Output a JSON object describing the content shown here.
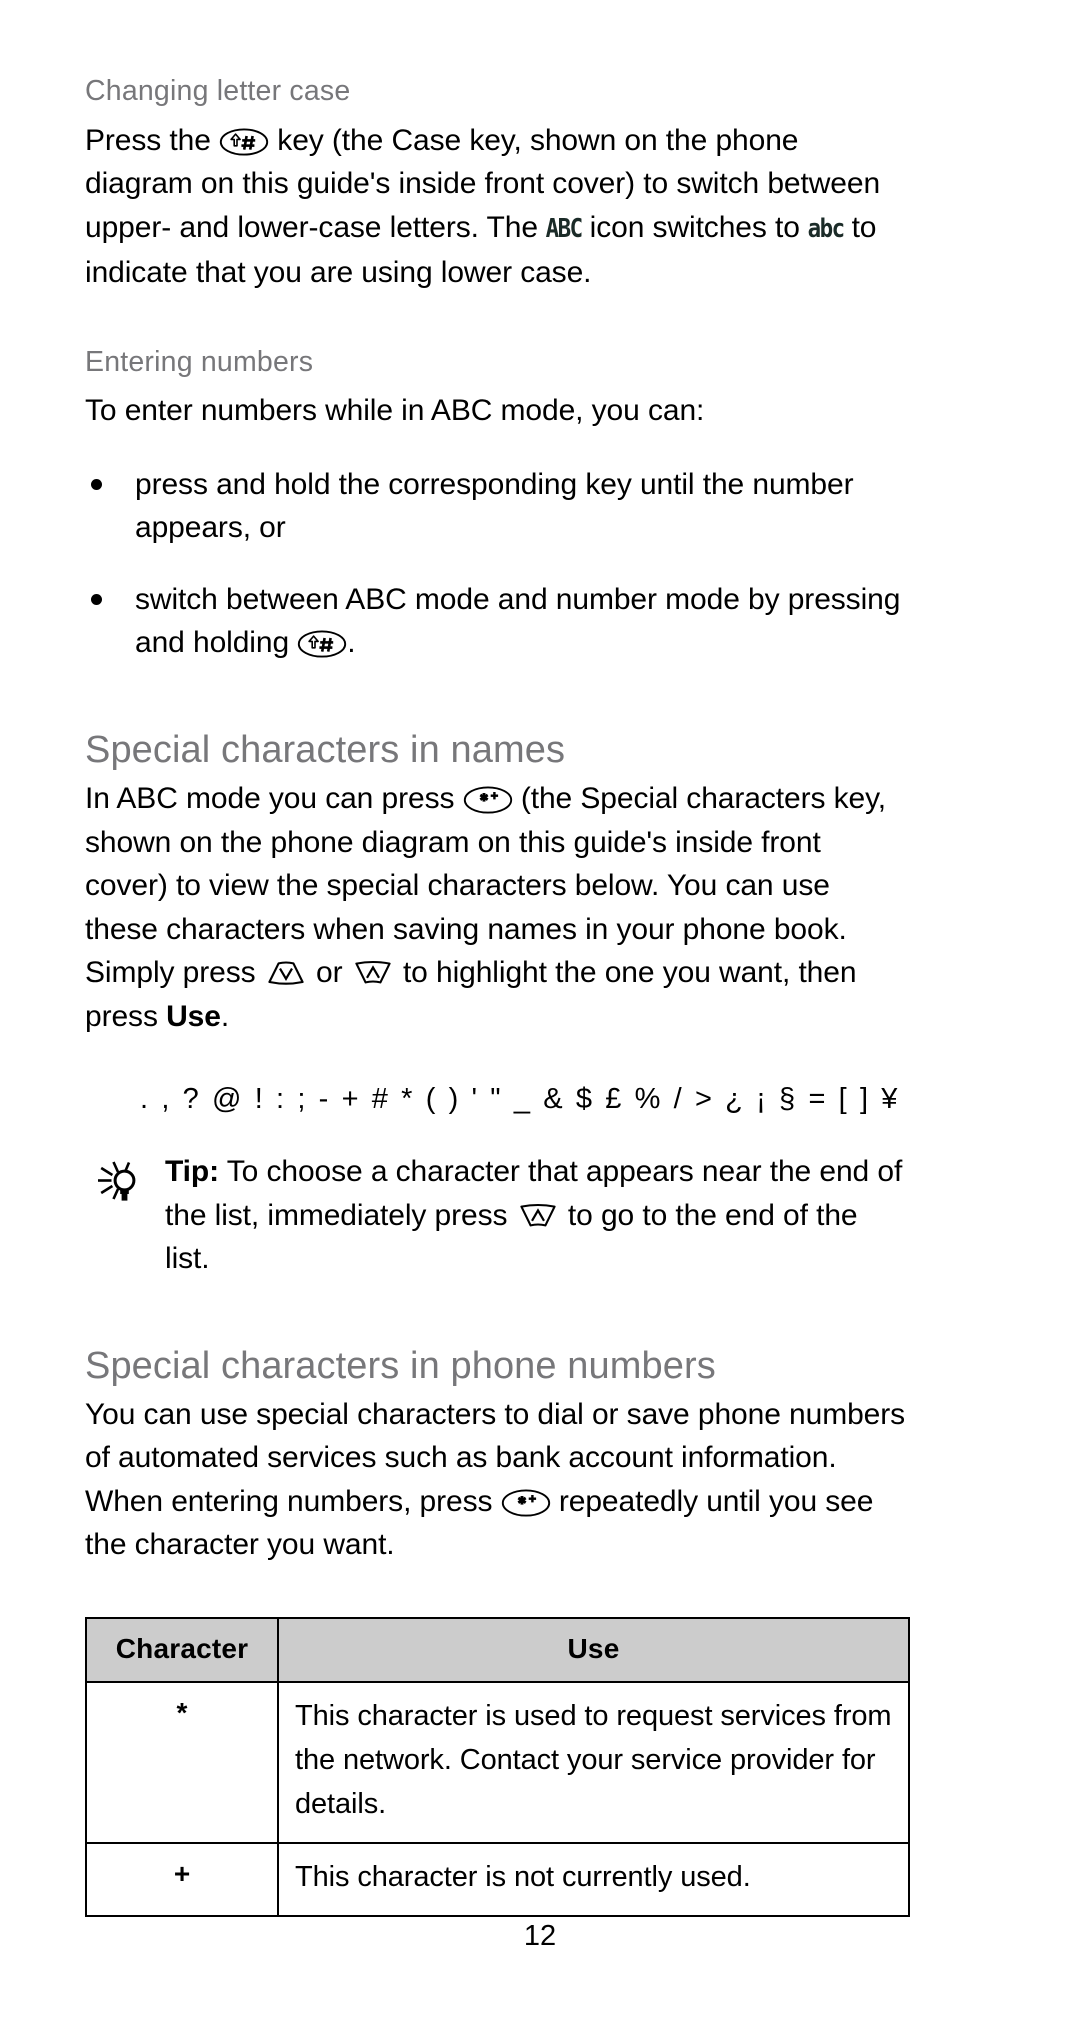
{
  "page": {
    "number": "12"
  },
  "sections": {
    "changing_letter_case": {
      "heading": "Changing letter case",
      "para_part1": "Press the ",
      "key_case": "case-key",
      "para_part2": " key (the Case key, shown on the phone diagram on this guide's inside front cover) to switch between upper- and lower-case letters. The ",
      "indicator_upper": "ABC",
      "para_part3": " icon switches to ",
      "indicator_lower": "abc",
      "para_part4": " to indicate that you are using lower case."
    },
    "entering_numbers": {
      "heading": "Entering numbers",
      "intro": "To enter numbers while in ABC mode, you can:",
      "bullets": [
        {
          "text": "press and hold the corresponding key until the number appears, or"
        },
        {
          "text_before": "switch between ABC mode and number mode by pressing and holding ",
          "key": "case-key",
          "text_after": "."
        }
      ]
    },
    "special_in_names": {
      "heading": "Special characters in names",
      "para_part1": "In ABC mode you can press ",
      "key_star": "special-characters-key",
      "para_part2": " (the Special characters key, shown on the phone diagram on this guide's inside front cover) to view the special characters below. You can use these characters when saving names in your phone book. Simply press ",
      "key_down": "scroll-down-key",
      "para_part3": " or ",
      "key_up": "scroll-up-key",
      "para_part4": " to highlight the one you want, then press ",
      "use_label": "Use",
      "para_part5": ".",
      "character_list": ". , ? @ ! : ; - + # * ( ) ' \" _ & $ £ % / > ¿ ¡ § = [ ] ¥",
      "tip": {
        "label": "Tip:",
        "text_before": " To choose a character that appears near the end of the list, immediately press ",
        "key": "scroll-up-key",
        "text_after": " to go to the end of the list."
      }
    },
    "special_in_phone_numbers": {
      "heading": "Special characters in phone numbers",
      "para_part1": "You can use special characters to dial or save phone numbers of automated services such as bank account information. When entering numbers, press ",
      "key_star": "special-characters-key",
      "para_part2": " repeatedly until you see the character you want.",
      "table": {
        "headers": [
          "Character",
          "Use"
        ],
        "rows": [
          {
            "character": "*",
            "use": "This character is used to request services from the network. Contact your service provider for details."
          },
          {
            "character": "+",
            "use": "This character is not currently used."
          }
        ]
      }
    }
  },
  "colors": {
    "heading_gray": "#77777a",
    "table_header_bg": "#cccccc",
    "lcd_indicator": "#1b2b28",
    "body_text": "#000000"
  }
}
